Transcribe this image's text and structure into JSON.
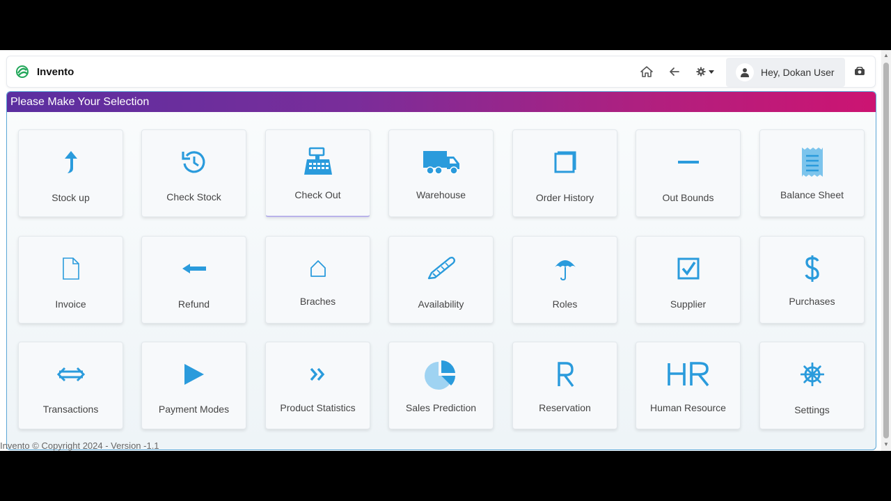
{
  "app": {
    "name": "Invento"
  },
  "header": {
    "nav_icons": [
      "home-icon",
      "back-arrow-icon",
      "gear-dropdown-icon"
    ],
    "user": {
      "greeting": "Hey, Dokan User"
    },
    "logout_icon": "logout-icon"
  },
  "panel": {
    "title": "Please Make Your Selection",
    "tiles": [
      {
        "label": "Stock up",
        "icon": "stock-up-icon"
      },
      {
        "label": "Check Stock",
        "icon": "refresh-icon"
      },
      {
        "label": "Check Out",
        "icon": "cash-register-icon"
      },
      {
        "label": "Warehouse",
        "icon": "truck-icon"
      },
      {
        "label": "Order History",
        "icon": "square-icon"
      },
      {
        "label": "Out Bounds",
        "icon": "minus-icon"
      },
      {
        "label": "Balance Sheet",
        "icon": "receipt-icon"
      },
      {
        "label": "Invoice",
        "icon": "document-icon"
      },
      {
        "label": "Refund",
        "icon": "arrow-left-icon"
      },
      {
        "label": "Braches",
        "icon": "house-icon"
      },
      {
        "label": "Availability",
        "icon": "pencil-icon"
      },
      {
        "label": "Roles",
        "icon": "umbrella-icon"
      },
      {
        "label": "Supplier",
        "icon": "checkbox-icon"
      },
      {
        "label": "Purchases",
        "icon": "dollar-icon"
      },
      {
        "label": "Transactions",
        "icon": "left-right-arrow-icon"
      },
      {
        "label": "Payment Modes",
        "icon": "play-icon"
      },
      {
        "label": "Product Statistics",
        "icon": "double-chevron-icon"
      },
      {
        "label": "Sales Prediction",
        "icon": "pie-chart-icon"
      },
      {
        "label": "Reservation",
        "icon": "r-letter-icon"
      },
      {
        "label": "Human Resource",
        "icon": "hr-letters-icon"
      },
      {
        "label": "Settings",
        "icon": "helm-icon"
      }
    ]
  },
  "footer": {
    "text": "Invento © Copyright 2024 - Version -1.1"
  },
  "colors": {
    "accent": "#2a9bdc",
    "header_gradient_start": "#5b2fa0",
    "header_gradient_end": "#cc1472"
  }
}
